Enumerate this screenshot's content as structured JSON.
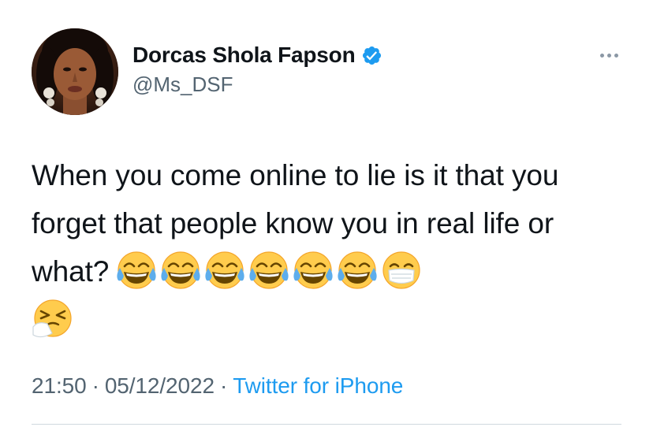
{
  "author": {
    "display_name": "Dorcas Shola Fapson",
    "handle": "@Ms_DSF",
    "verified": true
  },
  "tweet": {
    "text": "When you come online to lie is it that you forget that people know you in real life or what?",
    "emojis": [
      "face-with-tears-of-joy",
      "face-with-tears-of-joy",
      "face-with-tears-of-joy",
      "face-with-tears-of-joy",
      "face-with-tears-of-joy",
      "face-with-tears-of-joy",
      "face-with-medical-mask",
      "sneezing-face"
    ]
  },
  "meta": {
    "time": "21:50",
    "date": "05/12/2022",
    "separator": "·",
    "source": "Twitter for iPhone"
  },
  "colors": {
    "verified_blue": "#1d9bf0",
    "secondary_text": "#536471",
    "link": "#1d9bf0"
  }
}
